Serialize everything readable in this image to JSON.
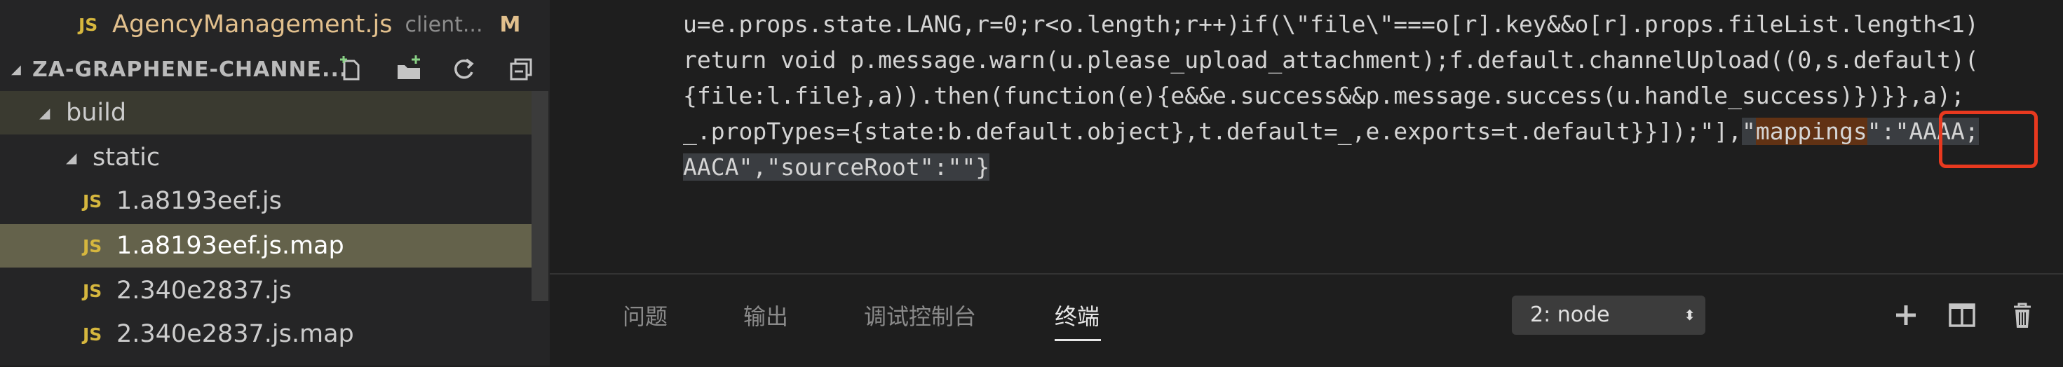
{
  "explorer": {
    "open_file": {
      "badge": "JS",
      "name": "AgencyManagement.js",
      "path_hint": "client...",
      "status": "M"
    },
    "section_title": "ZA-GRAPHENE-CHANNE...",
    "toolbar_icons": [
      "new-file-icon",
      "new-folder-icon",
      "refresh-icon",
      "collapse-all-icon"
    ],
    "tree": {
      "build": "build",
      "static": "static",
      "files": [
        {
          "badge": "JS",
          "name": "1.a8193eef.js"
        },
        {
          "badge": "JS",
          "name": "1.a8193eef.js.map"
        },
        {
          "badge": "JS",
          "name": "2.340e2837.js"
        },
        {
          "badge": "JS",
          "name": "2.340e2837.js.map"
        }
      ]
    }
  },
  "editor": {
    "line1": "u=e.props.state.LANG,r=0;r<o.length;r++)if(\\\"file\\\"===o[r].key&&o[r].props.fileList.length<1)",
    "line2": "return void p.message.warn(u.please_upload_attachment);f.default.channelUpload((0,s.default)(",
    "line3": "{file:l.file},a)).then(function(e){e&&e.success&&p.message.success(u.handle_success)})}},a);",
    "line4_prefix": "_.propTypes={state:b.default.object},t.default=_,e.exports=t.default}}]);\"],",
    "line4_q1": "\"",
    "line4_key": "mappings",
    "line4_q2": "\"",
    "line4_colon": ":",
    "line4_value": "\"AAAA;",
    "line5": "AACA\",\"sourceRoot\":\"\"}"
  },
  "panel": {
    "tabs": [
      "问题",
      "输出",
      "调试控制台",
      "终端"
    ],
    "active_tab": "终端",
    "terminal_select": "2: node",
    "actions": [
      "add-terminal-icon",
      "split-terminal-icon",
      "trash-icon"
    ]
  },
  "colors": {
    "js_badge": "#d6b73e",
    "modified_file": "#e2c08d",
    "highlight_box": "#e8391f"
  }
}
